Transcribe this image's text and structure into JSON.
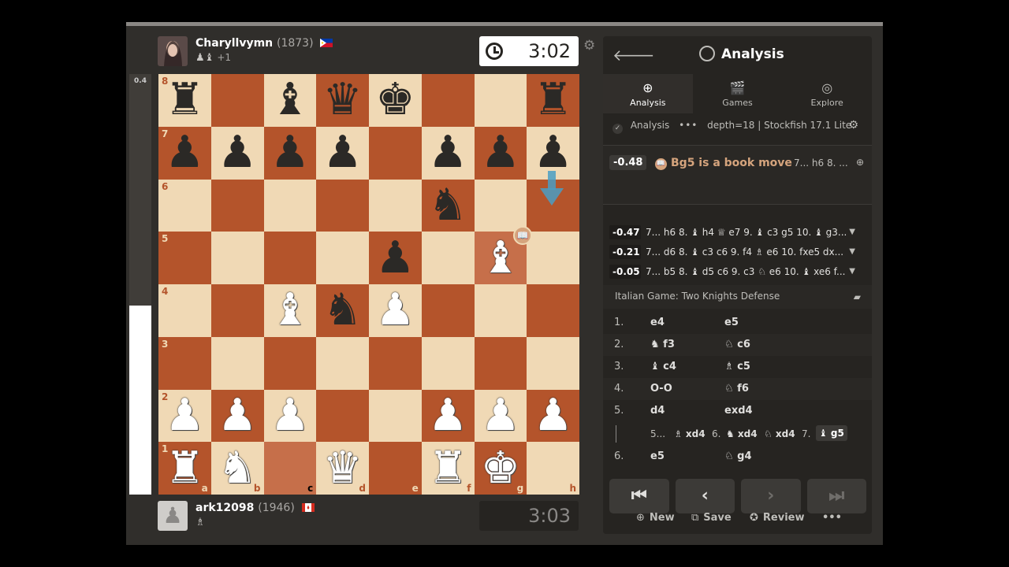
{
  "eval_bar": {
    "label": "0.4",
    "white_fraction": 0.45
  },
  "top_player": {
    "name": "Charyllvymn",
    "rating": "(1873)",
    "captured": "♟♝",
    "advantage": "+1",
    "clock": "3:02"
  },
  "bottom_player": {
    "name": "ark12098",
    "rating": "(1946)",
    "captured": "♗",
    "clock": "3:03"
  },
  "board": {
    "ranks": [
      "8",
      "7",
      "6",
      "5",
      "4",
      "3",
      "2",
      "1"
    ],
    "files": [
      "a",
      "b",
      "c",
      "d",
      "e",
      "f",
      "g",
      "h"
    ],
    "position": [
      [
        "bR",
        "",
        "bB",
        "bQ",
        "bK",
        "",
        "",
        "bR"
      ],
      [
        "bP",
        "bP",
        "bP",
        "bP",
        "",
        "bP",
        "bP",
        "bP"
      ],
      [
        "",
        "",
        "",
        "",
        "",
        "bN",
        "",
        ""
      ],
      [
        "",
        "",
        "",
        "",
        "bP",
        "",
        "wB",
        ""
      ],
      [
        "",
        "",
        "wB",
        "bN",
        "wP",
        "",
        "",
        ""
      ],
      [
        "",
        "",
        "",
        "",
        "",
        "",
        "",
        ""
      ],
      [
        "wP",
        "wP",
        "wP",
        "",
        "",
        "wP",
        "wP",
        "wP"
      ],
      [
        "wR",
        "wN",
        "",
        "wQ",
        "",
        "wR",
        "wK",
        ""
      ]
    ],
    "highlight": [
      "c1",
      "g5"
    ],
    "book_icon": "book-icon"
  },
  "panel": {
    "title": "Analysis",
    "tabs": [
      {
        "label": "Analysis",
        "icon": "⊕"
      },
      {
        "label": "Games",
        "icon": "🎬"
      },
      {
        "label": "Explore",
        "icon": "◎"
      }
    ],
    "engine": {
      "label": "Analysis",
      "info": "depth=18 | Stockfish 17.1 Lite"
    },
    "best": {
      "score": "-0.48",
      "text": "Bg5 is a book move",
      "line": "7... h6 8. ..."
    },
    "lines": [
      {
        "score": "-0.47",
        "text": "7... h6 8. ♝ h4 ♕ e7 9. ♝ c3 g5 10. ♝ g3..."
      },
      {
        "score": "-0.21",
        "text": "7... d6 8. ♝ c3 c6 9. f4 ♗ e6 10. fxe5 dx..."
      },
      {
        "score": "-0.05",
        "text": "7... b5 8. ♝ d5 c6 9. c3 ♘ e6 10. ♝ xe6 f..."
      }
    ],
    "opening": "Italian Game: Two Knights Defense",
    "moves": [
      {
        "num": "1.",
        "w": "e4",
        "b": "e5"
      },
      {
        "num": "2.",
        "w": "♞ f3",
        "b": "♘ c6"
      },
      {
        "num": "3.",
        "w": "♝ c4",
        "b": "♗ c5"
      },
      {
        "num": "4.",
        "w": "O-O",
        "b": "♘ f6"
      },
      {
        "num": "5.",
        "w": "d4",
        "b": "exd4"
      }
    ],
    "variation": {
      "n1": "5...",
      "m1": "♗ xd4",
      "n2": "6.",
      "m2": "♞ xd4",
      "m3": "♘ xd4",
      "n3": "7.",
      "m4": "♝ g5"
    },
    "move6": {
      "num": "6.",
      "w": "e5",
      "b": "♘ g4"
    },
    "nav": [
      "⏮",
      "‹",
      "›",
      "⏭"
    ],
    "actions": {
      "new": "New",
      "save": "Save",
      "review": "Review",
      "more": "•••"
    }
  }
}
